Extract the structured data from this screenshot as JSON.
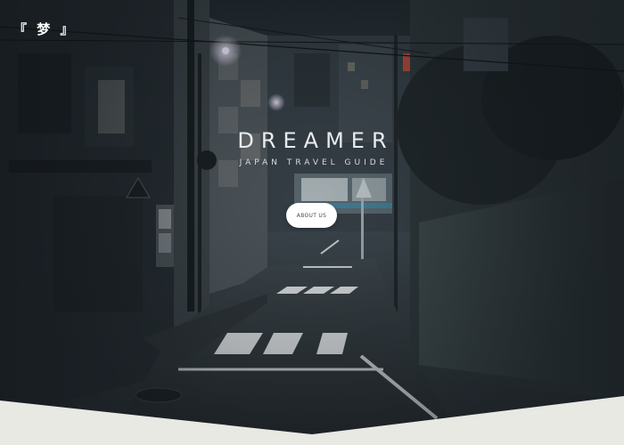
{
  "header": {
    "logo": "『 梦 』"
  },
  "hero": {
    "title": "DREAMER",
    "subtitle": "JAPAN TRAVEL GUIDE",
    "button_label": "ABOUT US"
  },
  "colors": {
    "background_dark": "#2a3035",
    "text_light": "#e9ecef",
    "button_bg": "#ffffff",
    "bottom_band": "#e7e9e2"
  }
}
